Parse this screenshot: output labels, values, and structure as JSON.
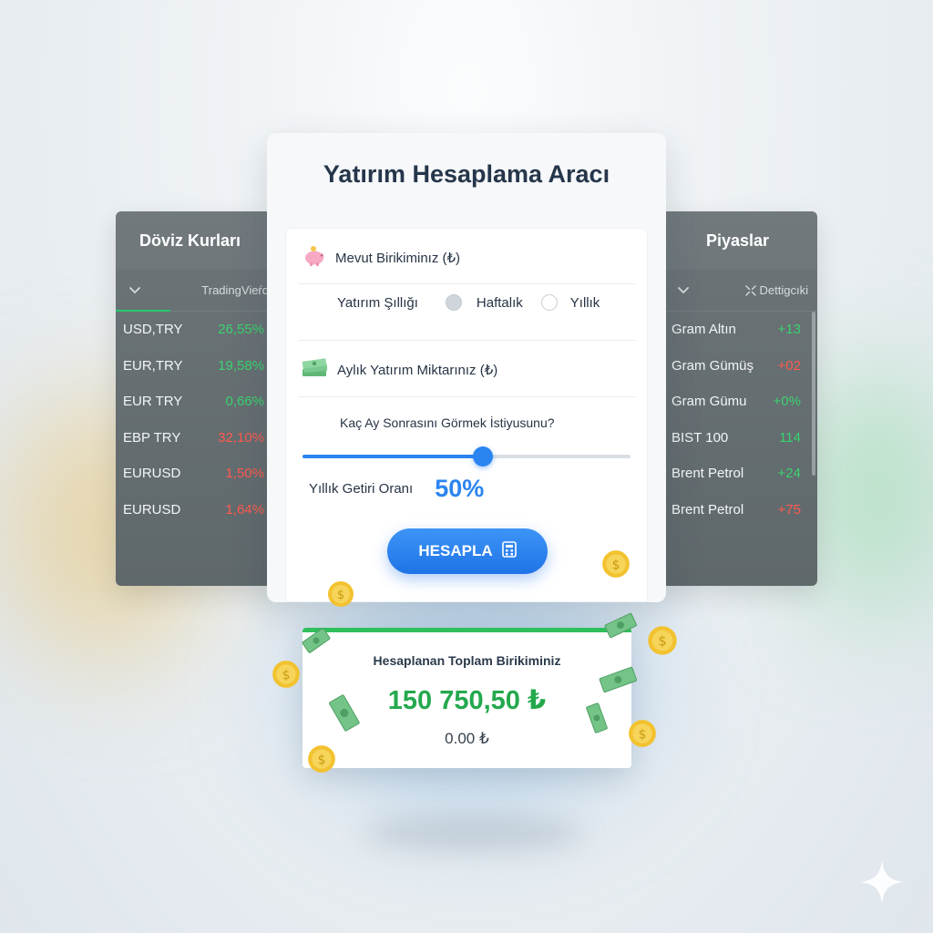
{
  "left_panel": {
    "title": "Döviz Kurları",
    "source": "TradingVieŕd",
    "rates": [
      {
        "pair": "USD,TRY",
        "change": "26,55%",
        "trend": "up"
      },
      {
        "pair": "EUR,TRY",
        "change": "19,58%",
        "trend": "up"
      },
      {
        "pair": "EUR TRY",
        "change": "0,66%",
        "trend": "up"
      },
      {
        "pair": "EBP TRY",
        "change": "32,10%",
        "trend": "down"
      },
      {
        "pair": "EURUSD",
        "change": "1,50%",
        "trend": "down"
      },
      {
        "pair": "EURUSD",
        "change": "1,64%",
        "trend": "down"
      }
    ]
  },
  "right_panel": {
    "title": "Piyaslar",
    "filter_label": "Dettigcıki",
    "markets": [
      {
        "name": "Gram Altın",
        "value": "+13",
        "trend": "up"
      },
      {
        "name": "Gram Gümüş",
        "value": "+02",
        "trend": "down"
      },
      {
        "name": "Gram Gümu",
        "value": "+0%",
        "trend": "up"
      },
      {
        "name": "BIST 100",
        "value": "114",
        "trend": "up"
      },
      {
        "name": "Brent Petrol",
        "value": "+24",
        "trend": "up"
      },
      {
        "name": "Brent Petrol",
        "value": "+75",
        "trend": "down"
      }
    ]
  },
  "calculator": {
    "title": "Yatırım Hesaplama Aracı",
    "savings_label": "Mevut Birikiminız (₺)",
    "frequency_label": "Yatırım Şıllığı",
    "frequency_options": [
      "Haftalık",
      "Yıllık"
    ],
    "frequency_selected_index": 0,
    "monthly_amount_label": "Aylık Yatırım Miktarınız (₺)",
    "months_label": "Kaç Ay Sonrasını Görmek İstiyusunu?",
    "months_slider_fraction": 0.55,
    "annual_return_label": "Yıllık Getiri Oranı",
    "annual_return_value": "50%",
    "calculate_button": "HESAPLA"
  },
  "result": {
    "title": "Hesaplanan Toplam Birikiminiz",
    "total": "150 750,50 ₺",
    "secondary": "0.00 ₺"
  },
  "colors": {
    "accent_blue": "#2b84f0",
    "positive_green": "#39d36f",
    "negative_red": "#ff5a4e",
    "result_green": "#24a94d"
  },
  "icons": {
    "savings": "piggy-bank-icon",
    "monthly_amount": "money-stack-icon",
    "calculate": "calculator-icon",
    "panel_toggle": "chevron-down-icon",
    "filter": "collapse-arrows-icon"
  }
}
